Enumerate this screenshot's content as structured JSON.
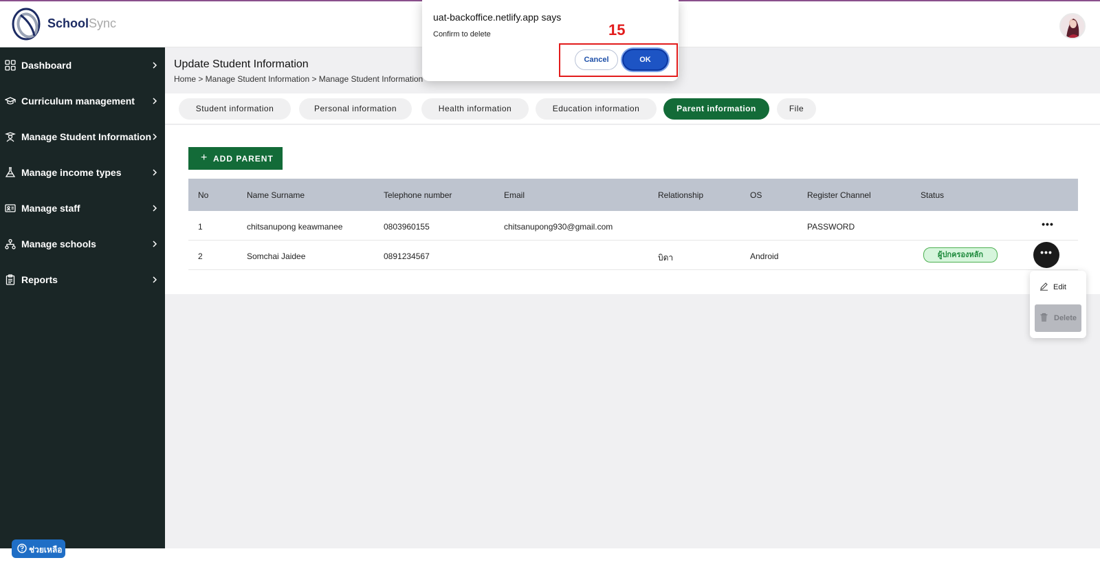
{
  "brand": {
    "part1": "School",
    "part2": "Sync"
  },
  "sidebar": {
    "items": [
      {
        "label": "Dashboard",
        "icon": "grid-icon"
      },
      {
        "label": "Curriculum management",
        "icon": "graduation-cap-icon"
      },
      {
        "label": "Manage Student Information",
        "icon": "student-icon"
      },
      {
        "label": "Manage income types",
        "icon": "flask-icon"
      },
      {
        "label": "Manage staff",
        "icon": "id-card-icon"
      },
      {
        "label": "Manage schools",
        "icon": "hierarchy-icon"
      },
      {
        "label": "Reports",
        "icon": "clipboard-icon"
      }
    ]
  },
  "help": {
    "label": "ช่วยเหลือ"
  },
  "page": {
    "title": "Update Student Information",
    "breadcrumb": "Home > Manage Student Information > Manage Student Information"
  },
  "tabs": [
    {
      "label": "Student information",
      "active": false
    },
    {
      "label": "Personal information",
      "active": false
    },
    {
      "label": "Health information",
      "active": false
    },
    {
      "label": "Education information",
      "active": false
    },
    {
      "label": "Parent information",
      "active": true
    },
    {
      "label": "File",
      "active": false
    }
  ],
  "add_button": {
    "icon": "+",
    "label": "ADD PARENT"
  },
  "table": {
    "headers": [
      "No",
      "Name Surname",
      "Telephone number",
      "Email",
      "Relationship",
      "OS",
      "Register Channel",
      "Status"
    ],
    "rows": [
      {
        "no": "1",
        "name": "chitsanupong keawmanee",
        "phone": "0803960155",
        "email": "chitsanupong930@gmail.com",
        "relationship": "",
        "os": "",
        "channel": "PASSWORD",
        "status": ""
      },
      {
        "no": "2",
        "name": "Somchai Jaidee",
        "phone": "0891234567",
        "email": "",
        "relationship": "บิดา",
        "os": "Android",
        "channel": "",
        "status": "ผู้ปกครองหลัก"
      }
    ],
    "actions_glyph": "•••"
  },
  "row_menu": {
    "edit": "Edit",
    "delete": "Delete"
  },
  "dialog": {
    "title": "uat-backoffice.netlify.app says",
    "message": "Confirm to delete",
    "cancel": "Cancel",
    "ok": "OK",
    "step": "15"
  },
  "colors": {
    "sidebar_bg": "#1a2626",
    "accent_green": "#136b38",
    "ok_blue": "#1d54c4",
    "highlight_red": "#e21b1b",
    "table_header": "#bec4cf"
  }
}
